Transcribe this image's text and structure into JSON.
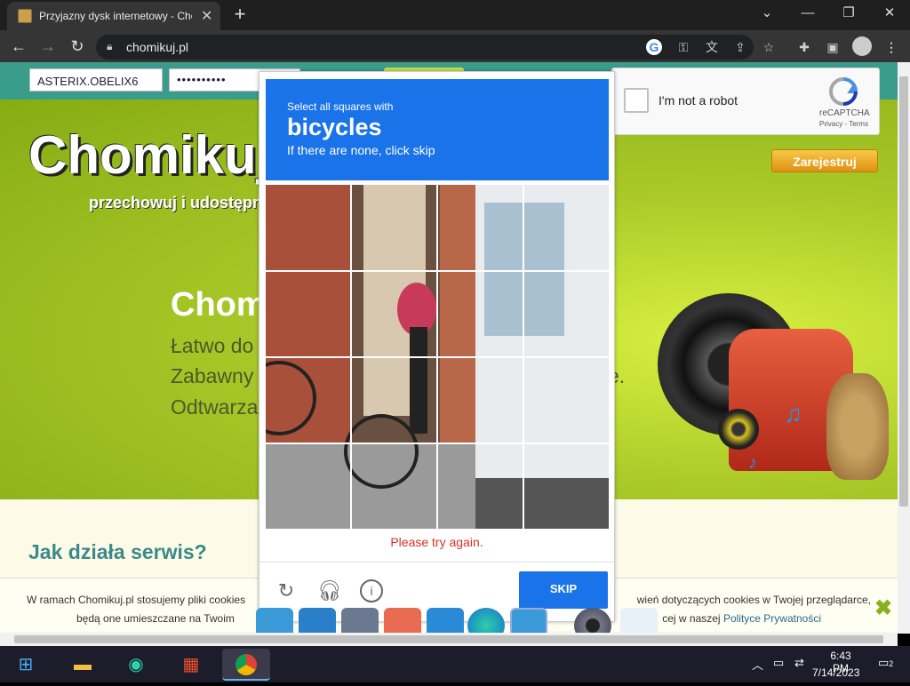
{
  "browser": {
    "tab_title": "Przyjazny dysk internetowy - Cho",
    "tab_close": "✕",
    "new_tab": "+",
    "window_controls": {
      "chevron": "⌄",
      "minimize": "—",
      "restore": "❐",
      "close": "✕"
    },
    "nav": {
      "back": "←",
      "forward": "→",
      "reload": "↻"
    },
    "url": "chomikuj.pl",
    "toolbar_icons": [
      "google-icon",
      "key-icon",
      "translate-icon",
      "share-icon",
      "star-icon",
      "extensions-icon",
      "sidepanel-icon",
      "profile-icon",
      "menu-icon"
    ]
  },
  "page": {
    "login_value": "ASTERIX.OBELIX6",
    "password_value": "••••••••••",
    "brand": "Chomikuj.",
    "tagline": "przechowuj i udostępni",
    "headline": "Chom",
    "features": [
      "Łatwo do",
      "Zabawny",
      "Odtwarza"
    ],
    "feature_tail": "e.",
    "register": "Zarejestruj",
    "how_it_works": "Jak działa serwis?",
    "cookie_line1_a": "W ramach Chomikuj.pl stosujemy pliki cookies",
    "cookie_line1_b": "wień dotyczących cookies w Twojej przeglądarce,",
    "cookie_line2_a": "będą one umieszczane na Twoim",
    "cookie_line2_b": "cej w naszej",
    "cookie_link": "Polityce Prywatności",
    "cookie_close": "✖"
  },
  "recaptcha": {
    "label": "I'm not a robot",
    "brand": "reCAPTCHA",
    "terms": "Privacy - Terms"
  },
  "challenge": {
    "instruction": "Select all squares with",
    "object": "bicycles",
    "hint": "If there are none, click skip",
    "error": "Please try again.",
    "skip": "SKIP",
    "footer_icons": [
      "reload-icon",
      "audio-icon",
      "info-icon"
    ]
  },
  "taskbar": {
    "time": "6:43 PM",
    "date": "7/14/2023",
    "notification_count": "2",
    "apps": [
      "windows-start-icon",
      "file-explorer-icon",
      "edge-icon",
      "store-icon",
      "chrome-icon"
    ]
  },
  "colors": {
    "accent": "#1a73e8",
    "error": "#d93025",
    "site_green": "#a8c828",
    "site_teal": "#3a9c8a"
  }
}
